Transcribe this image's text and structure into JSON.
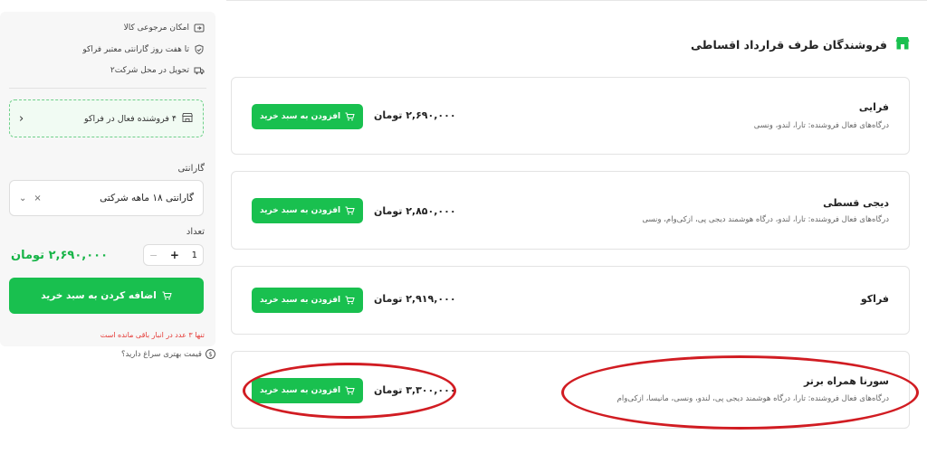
{
  "sidebar": {
    "features": [
      {
        "icon": "return-icon",
        "label": "امکان مرجوعی کالا"
      },
      {
        "icon": "shield-check-icon",
        "label": "تا هفت روز گارانتی معتبر فراکو"
      },
      {
        "icon": "truck-icon",
        "label": "تحویل در محل شرکت۲"
      }
    ],
    "active_sellers": "۴ فروشنده فعال در فراکو",
    "warranty_label": "گارانتی",
    "warranty_value": "گارانتی ۱۸ ماهه شرکتی",
    "quantity_label": "تعداد",
    "quantity_value": "1",
    "price": "۲,۶۹۰,۰۰۰ تومان",
    "add_to_cart_label": "اضافه کردن به سبد خرید",
    "stock_note": "تنها ۳ عدد در انبار باقی مانده است",
    "better_price": "قیمت بهتری سراغ دارید؟"
  },
  "section": {
    "title": "فروشندگان طرف قرارداد اقساطی"
  },
  "sellers": [
    {
      "name": "فرایی",
      "gateways": "درگاه‌های فعال فروشنده: تارا، لندو، ونسی",
      "price": "۲,۶۹۰,۰۰۰ تومان",
      "button": "افزودن به سبد خرید"
    },
    {
      "name": "دیجی قسطی",
      "gateways": "درگاه‌های فعال فروشنده: تارا، لندو، درگاه هوشمند دیجی پی، ازکی‌وام، ونسی",
      "price": "۲,۸۵۰,۰۰۰ تومان",
      "button": "افزودن به سبد خرید"
    },
    {
      "name": "فراکو",
      "gateways": "",
      "price": "۲,۹۱۹,۰۰۰ تومان",
      "button": "افزودن به سبد خرید"
    },
    {
      "name": "سورنا همراه برتر",
      "gateways": "درگاه‌های فعال فروشنده: تارا، درگاه هوشمند دیجی پی، لندو، ونسی، مانیسا، ازکی‌وام",
      "price": "۳,۳۰۰,۰۰۰ تومان",
      "button": "افزودن به سبد خرید"
    }
  ],
  "colors": {
    "accent": "#19c04f",
    "annotation": "#d11c22"
  }
}
